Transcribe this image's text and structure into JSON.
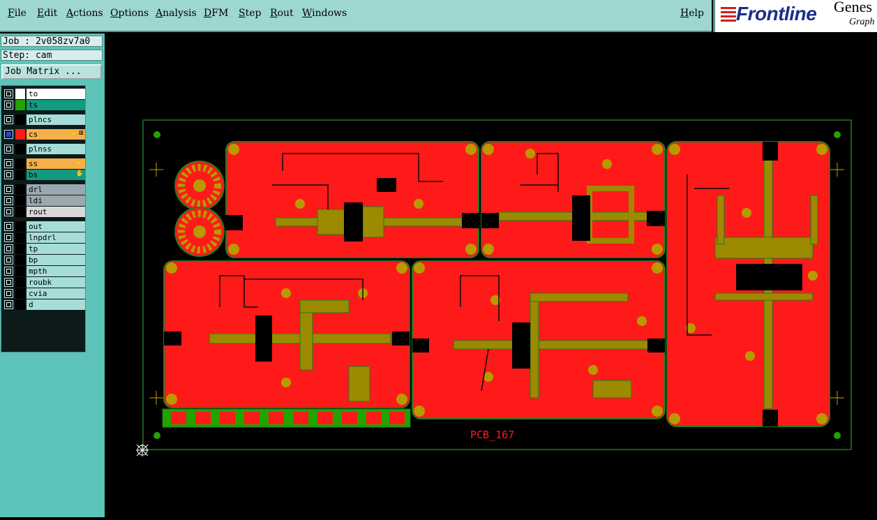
{
  "menubar": {
    "items": [
      "File",
      "Edit",
      "Actions",
      "Options",
      "Analysis",
      "DFM",
      "Step",
      "Rout",
      "Windows"
    ],
    "help": "Help"
  },
  "brand": {
    "logo": "Frontline",
    "product": "Genes",
    "product_sub": "Graph"
  },
  "panel": {
    "job": "Job : 2v058zv7a0",
    "step": "Step: cam",
    "job_matrix": "Job Matrix ..."
  },
  "layers": [
    {
      "name": "to",
      "swatch": "#ffffff",
      "bg": "#ffffff",
      "active": false,
      "icon": ""
    },
    {
      "name": "ts",
      "swatch": "#23a300",
      "bg": "#129a80",
      "active": false,
      "icon": ""
    },
    {
      "name": "plncs",
      "swatch": "#000000",
      "bg": "#a6ddd8",
      "active": false,
      "icon": ""
    },
    {
      "name": "cs",
      "swatch": "#ff1a1a",
      "bg": "#f5b04a",
      "active": true,
      "icon": "✋⊞"
    },
    {
      "name": "plnss",
      "swatch": "#000000",
      "bg": "#a6ddd8",
      "active": false,
      "icon": ""
    },
    {
      "name": "ss",
      "swatch": "#000000",
      "bg": "#f5b04a",
      "active": false,
      "icon": "✋"
    },
    {
      "name": "bs",
      "swatch": "#000000",
      "bg": "#129a80",
      "active": false,
      "icon": "✋"
    },
    {
      "name": "drl",
      "swatch": "#000000",
      "bg": "#9aa8b0",
      "active": false,
      "icon": ""
    },
    {
      "name": "ldi",
      "swatch": "#000000",
      "bg": "#9aa8b0",
      "active": false,
      "icon": ""
    },
    {
      "name": "rout",
      "swatch": "#000000",
      "bg": "#d8d8d8",
      "active": false,
      "icon": ""
    },
    {
      "name": "out",
      "swatch": "#000000",
      "bg": "#a6ddd8",
      "active": false,
      "icon": ""
    },
    {
      "name": "lnpdrl",
      "swatch": "#000000",
      "bg": "#a6ddd8",
      "active": false,
      "icon": ""
    },
    {
      "name": "tp",
      "swatch": "#000000",
      "bg": "#a6ddd8",
      "active": false,
      "icon": ""
    },
    {
      "name": "bp",
      "swatch": "#000000",
      "bg": "#a6ddd8",
      "active": false,
      "icon": ""
    },
    {
      "name": "mpth",
      "swatch": "#000000",
      "bg": "#a6ddd8",
      "active": false,
      "icon": ""
    },
    {
      "name": "roubk",
      "swatch": "#000000",
      "bg": "#a6ddd8",
      "active": false,
      "icon": ""
    },
    {
      "name": "cvia",
      "swatch": "#000000",
      "bg": "#a6ddd8",
      "active": false,
      "icon": ""
    },
    {
      "name": "d",
      "swatch": "#000000",
      "bg": "#a6ddd8",
      "active": false,
      "icon": ""
    }
  ],
  "board": {
    "label": "PCB_167",
    "colors": {
      "copper": "#ff1a1a",
      "gold": "#b89a00",
      "trace": "#9c8a00",
      "outline": "#1f7a1f",
      "pad": "#23a300"
    }
  }
}
